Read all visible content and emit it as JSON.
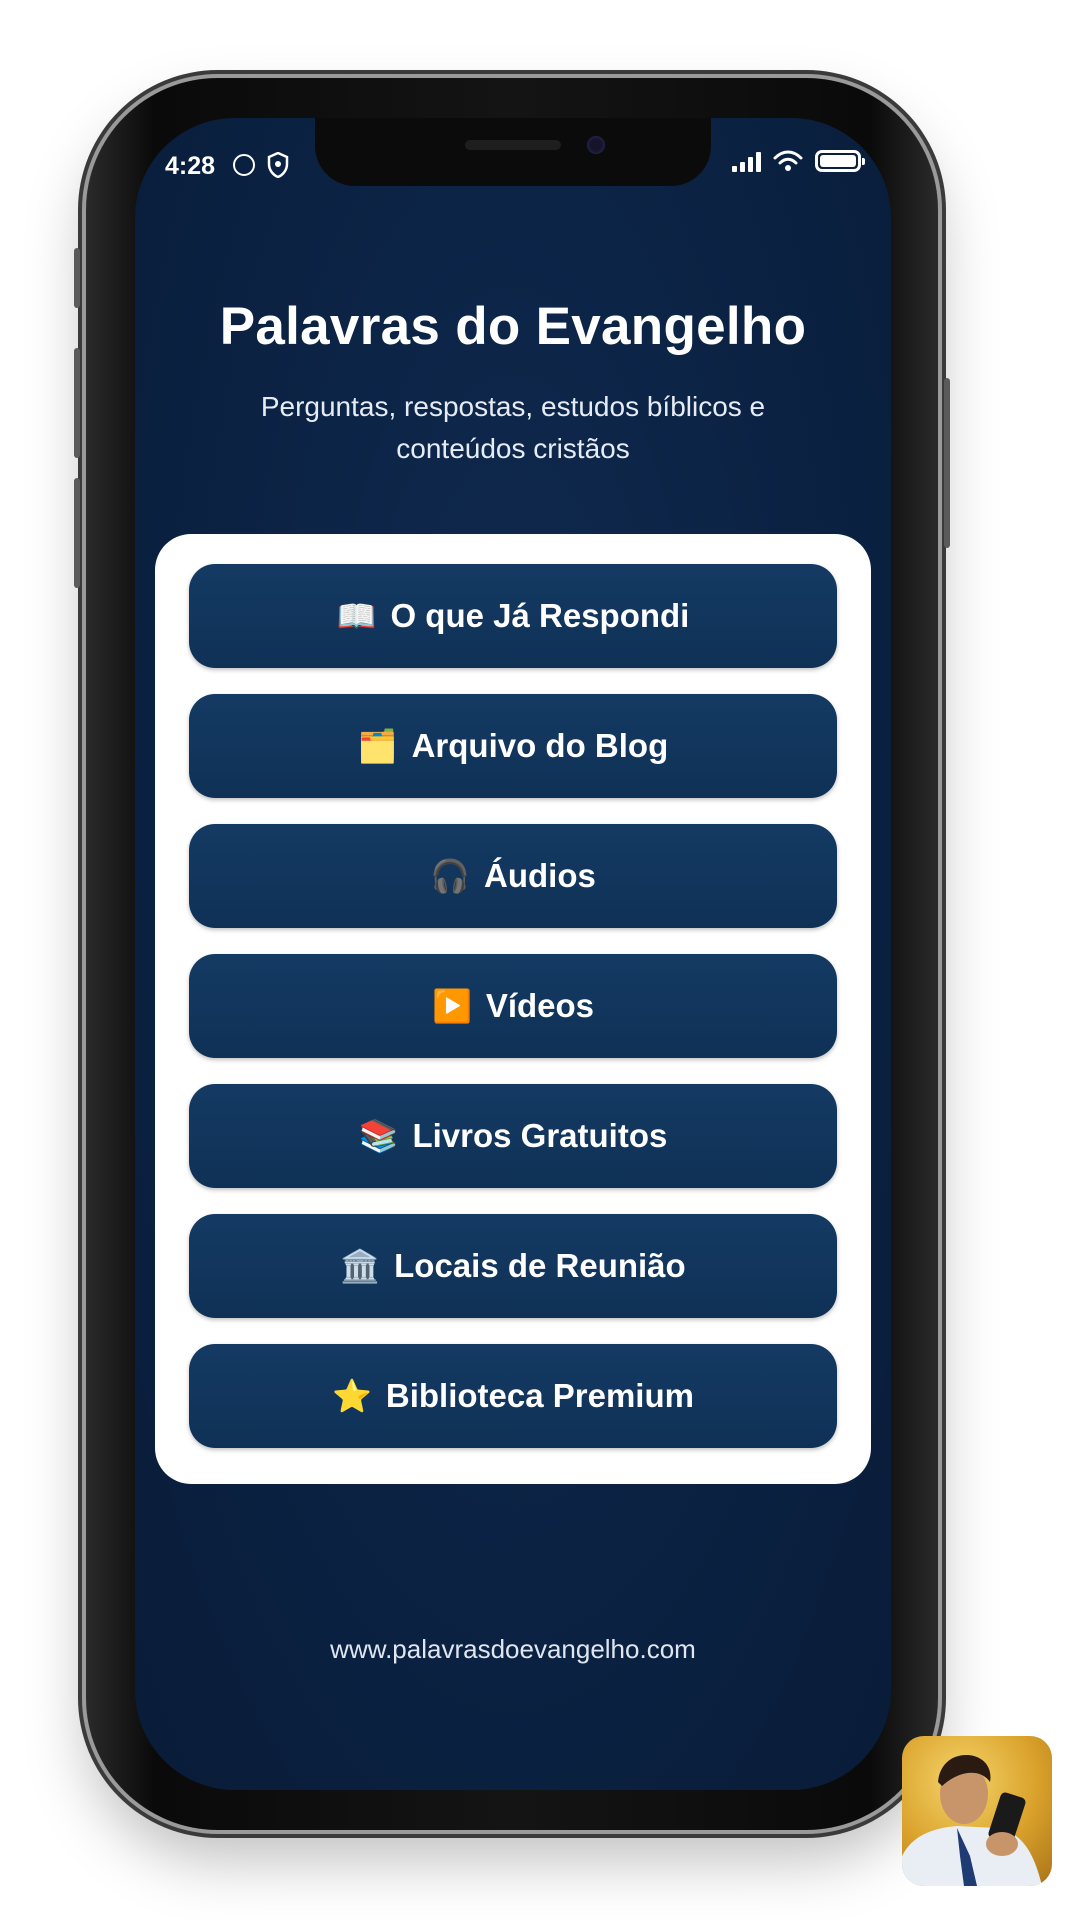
{
  "status_bar": {
    "time": "4:28"
  },
  "header": {
    "title": "Palavras do Evangelho",
    "subtitle": "Perguntas, respostas, estudos bíblicos e conteúdos cristãos"
  },
  "menu": [
    {
      "icon": "📖",
      "icon_name": "open-book-icon",
      "label": "O que Já Respondi"
    },
    {
      "icon": "🗂️",
      "icon_name": "folder-icon",
      "label": "Arquivo do Blog"
    },
    {
      "icon": "🎧",
      "icon_name": "headphones-icon",
      "label": "Áudios"
    },
    {
      "icon": "▶️",
      "icon_name": "play-icon",
      "label": "Vídeos"
    },
    {
      "icon": "📚",
      "icon_name": "books-icon",
      "label": "Livros Gratuitos"
    },
    {
      "icon": "🏛️",
      "icon_name": "building-icon",
      "label": "Locais de Reunião"
    },
    {
      "icon": "⭐",
      "icon_name": "star-icon",
      "label": "Biblioteca Premium"
    }
  ],
  "footer": {
    "url": "www.palavrasdoevangelho.com"
  },
  "colors": {
    "screen_bg": "#0b2243",
    "button_bg": "#143a63",
    "card_bg": "#ffffff",
    "text": "#ffffff"
  }
}
